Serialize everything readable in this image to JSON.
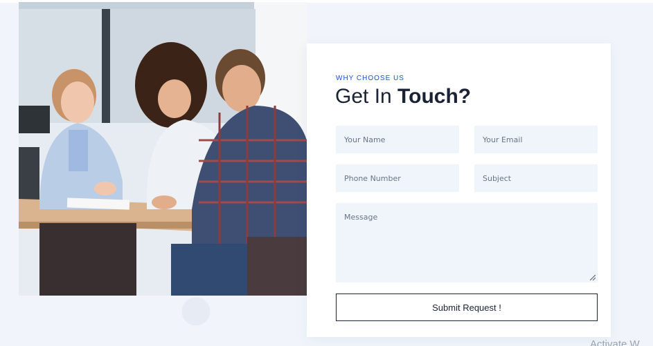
{
  "section": {
    "eyebrow": "WHY CHOOSE US",
    "heading_regular": "Get In ",
    "heading_bold": "Touch?"
  },
  "form": {
    "name_placeholder": "Your Name",
    "email_placeholder": "Your Email",
    "phone_placeholder": "Phone Number",
    "subject_placeholder": "Subject",
    "message_placeholder": "Message",
    "submit_label": "Submit Request !"
  },
  "overlay": {
    "watermark_text": "Activate W"
  },
  "colors": {
    "accent": "#1a4fd1",
    "heading": "#1b2236",
    "field_bg": "#f0f5fc",
    "page_bg": "#f1f5fb"
  },
  "image": {
    "alt": "team-meeting-photo"
  }
}
